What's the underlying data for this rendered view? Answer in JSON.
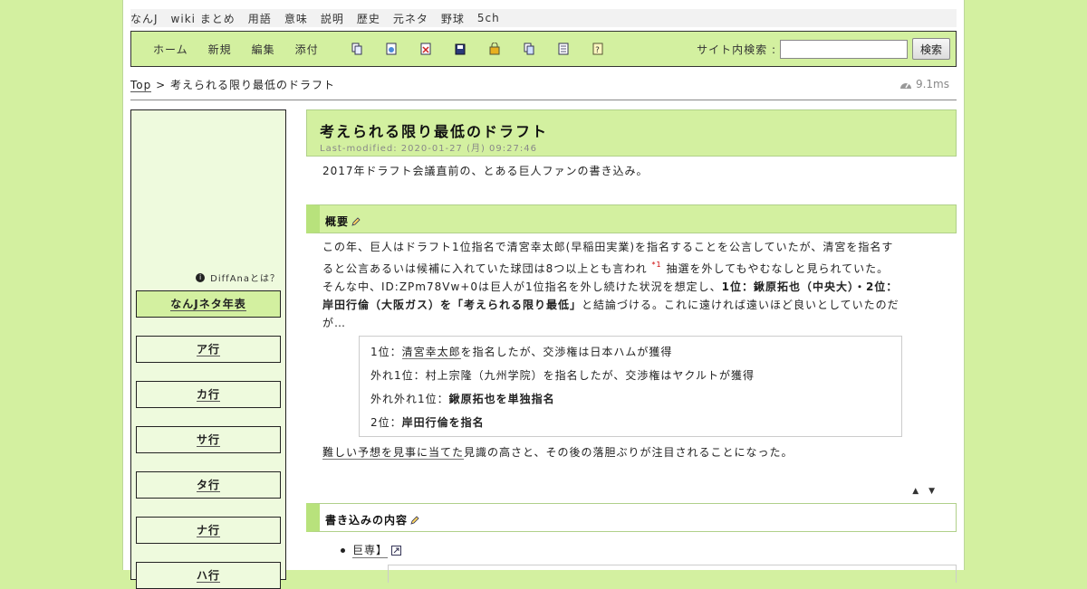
{
  "topnav": [
    "なんJ",
    "wiki まとめ",
    "用語",
    "意味",
    "説明",
    "歴史",
    "元ネタ",
    "野球",
    "5ch"
  ],
  "menu": {
    "links": [
      "ホーム",
      "新規",
      "編集",
      "添付"
    ],
    "icons": [
      "copy-icon",
      "rename-icon",
      "diff-icon",
      "backup-icon",
      "freeze-icon",
      "list-icon",
      "recent-icon",
      "help-icon"
    ],
    "search_label": "サイト内検索 :",
    "search_value": "",
    "search_button": "検索"
  },
  "breadcrumb": {
    "top": "Top",
    "sep": " > ",
    "current": "考えられる限り最低のドラフト"
  },
  "render_time": "9.1ms",
  "sidebar": {
    "diffana": "DiffAnaとは？",
    "items": [
      {
        "label": "なんJネタ年表",
        "highlight": true
      },
      {
        "label": "ア行"
      },
      {
        "label": "カ行"
      },
      {
        "label": "サ行"
      },
      {
        "label": "タ行"
      },
      {
        "label": "ナ行"
      },
      {
        "label": "ハ行"
      }
    ]
  },
  "main": {
    "title": "考えられる限り最低のドラフト",
    "last_modified": "Last-modified: 2020-01-27 (月) 09:27:46",
    "intro": "2017年ドラフト会議直前の、とある巨人ファンの書き込み。",
    "section1_title": "概要",
    "overview": {
      "line1": "この年、巨人はドラフト1位指名で清宮幸太郎(早稲田実業)を指名することを公言していたが、清宮を指名す",
      "line2a": "ると公言あるいは候補に入れていた球団は8つ以上とも言われ",
      "note": "*1",
      "line2b": "抽選を外してもやむなしと見られていた。",
      "line3a": "そんな中、ID:ZPm78Vw+0は巨人が1位指名を外し続けた状況を想定し、",
      "line3b": "1位：鍬原拓也（中央大）・2位：",
      "line4a": "岸田行倫（大阪ガス）を「考えられる限り最低」",
      "line4b": "と結論づける。これに遠ければ遠いほど良いとしていたのだ",
      "line5": "が…"
    },
    "quote": {
      "q1a": "1位：",
      "q1b": "清宮幸太郎",
      "q1c": "を指名したが、交渉権は日本ハムが獲得",
      "q2": "外れ1位：村上宗隆（九州学院）を指名したが、交渉権はヤクルトが獲得",
      "q3a": "外れ外れ1位：",
      "q3b": "鍬原拓也を単独指名",
      "q4a": "2位：",
      "q4b": "岸田行倫を指名"
    },
    "after_a": "難しい予想を見事に当てた",
    "after_b": "見識の高さと、その後の落胆ぶりが注目されることになった。",
    "arrows": "▲ ▼",
    "section2_title": "書き込みの内容",
    "bullet": "巨専】"
  }
}
